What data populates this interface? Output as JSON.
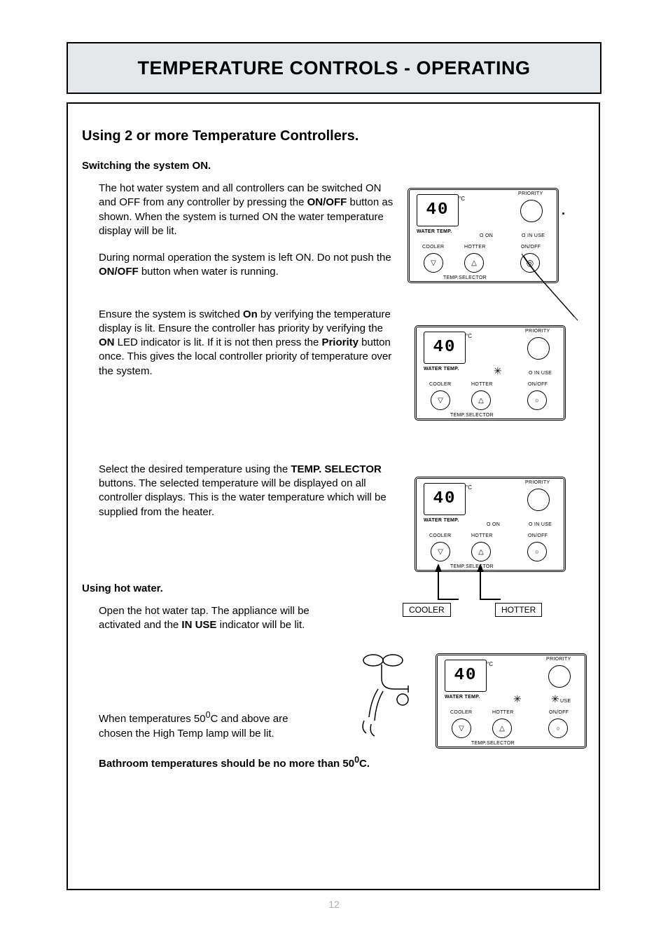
{
  "page_number": "12",
  "banner_title": "TEMPERATURE CONTROLS - OPERATING",
  "section_title": "Using 2 or more Temperature Controllers.",
  "switching_on_heading": "Switching the system ON.",
  "para1_pre": "The hot water system and all controllers can be switched ON and OFF from any controller by pressing the ",
  "para1_bold": "ON/OFF",
  "para1_post": " button as shown. When the system is turned ON the water temperature display will be lit.",
  "para2_pre": "During normal operation the system is left ON. Do not push the ",
  "para2_bold": "ON/OFF",
  "para2_post": " button when water is running.",
  "para3_pre": "Ensure the system is switched ",
  "para3_bold1": "On",
  "para3_mid1": " by verifying the temperature display is lit. Ensure the controller has priority by verifying the ",
  "para3_bold2": "ON",
  "para3_mid2": " LED indicator is lit. If it is not then press the ",
  "para3_bold3": "Priority",
  "para3_post": " button once. This gives the local controller priority of temperature over the system.",
  "para4_pre": "Select the desired temperature using the ",
  "para4_bold": "TEMP. SELECTOR",
  "para4_post": " buttons. The selected temperature will be displayed on all controller displays. This is the water temperature which will be supplied from the heater.",
  "using_hotwater_heading": "Using hot water.",
  "para5_pre": "Open the hot water tap. The appliance will be activated and the ",
  "para5_bold": "IN USE",
  "para5_post": " indicator will be lit.",
  "para6_pre": "When temperatures 50",
  "para6_sup": "0",
  "para6_post": "C and above are chosen the High Temp lamp will be lit.",
  "bathroom_warning_pre": "Bathroom temperatures should be no more than 50",
  "bathroom_warning_sup": "0",
  "bathroom_warning_post": "C.",
  "controller": {
    "display_temp": "40",
    "deg_unit": "°C",
    "labels": {
      "water_temp": "WATER TEMP.",
      "priority": "PRIORITY",
      "on": "O ON",
      "in_use": "O IN USE",
      "cooler": "COOLER",
      "hotter": "HOTTER",
      "on_off": "ON/OFF",
      "temp_selector": "TEMP.SELECTOR"
    }
  },
  "callout_cooler": "COOLER",
  "callout_hotter": "HOTTER"
}
